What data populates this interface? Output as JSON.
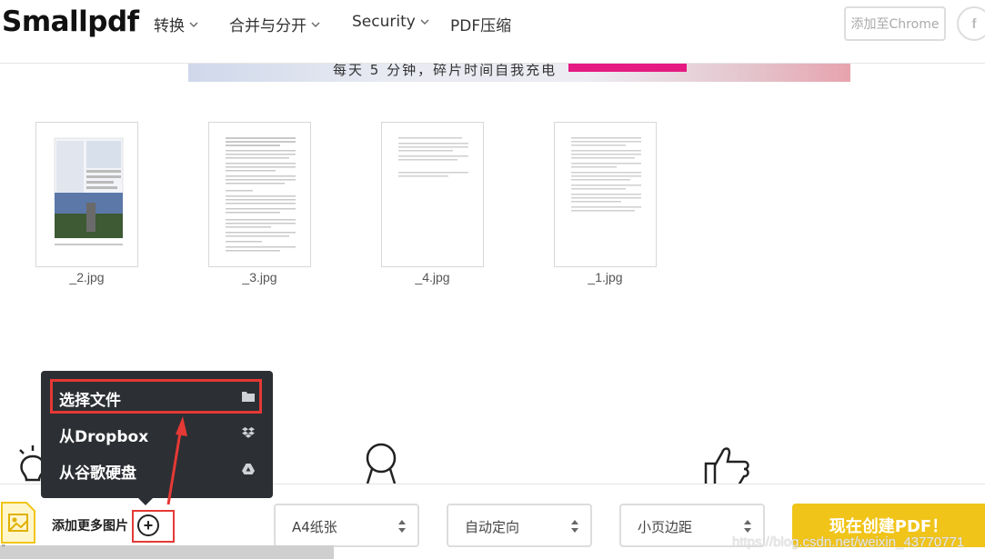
{
  "header": {
    "logo": "Smallpdf",
    "nav": [
      {
        "label": "转换"
      },
      {
        "label": "合并与分开"
      },
      {
        "label": "Security"
      },
      {
        "label": "PDF压缩"
      }
    ],
    "chrome_button": "添加至Chrome",
    "facebook_button": "f"
  },
  "banner": {
    "text": "每天 5 分钟，碎片时间自我充电"
  },
  "files": [
    {
      "name": "_2.jpg"
    },
    {
      "name": "_3.jpg"
    },
    {
      "name": "_4.jpg"
    },
    {
      "name": "_1.jpg"
    }
  ],
  "menu": {
    "items": [
      {
        "label": "选择文件",
        "icon": "folder-icon"
      },
      {
        "label": "从Dropbox",
        "icon": "dropbox-icon"
      },
      {
        "label": "从谷歌硬盘",
        "icon": "google-drive-icon"
      }
    ]
  },
  "bottombar": {
    "add_more": "添加更多图片",
    "add_symbol": "+",
    "page_size": "A4纸张",
    "orientation": "自动定向",
    "margin": "小页边距",
    "cta": "现在创建PDF！",
    "progress_text": "\""
  },
  "watermark": "https://blog.csdn.net/weixin_43770771",
  "colors": {
    "accent_yellow": "#f0c419",
    "highlight_red": "#e53935",
    "menu_bg": "#2c2f33"
  }
}
